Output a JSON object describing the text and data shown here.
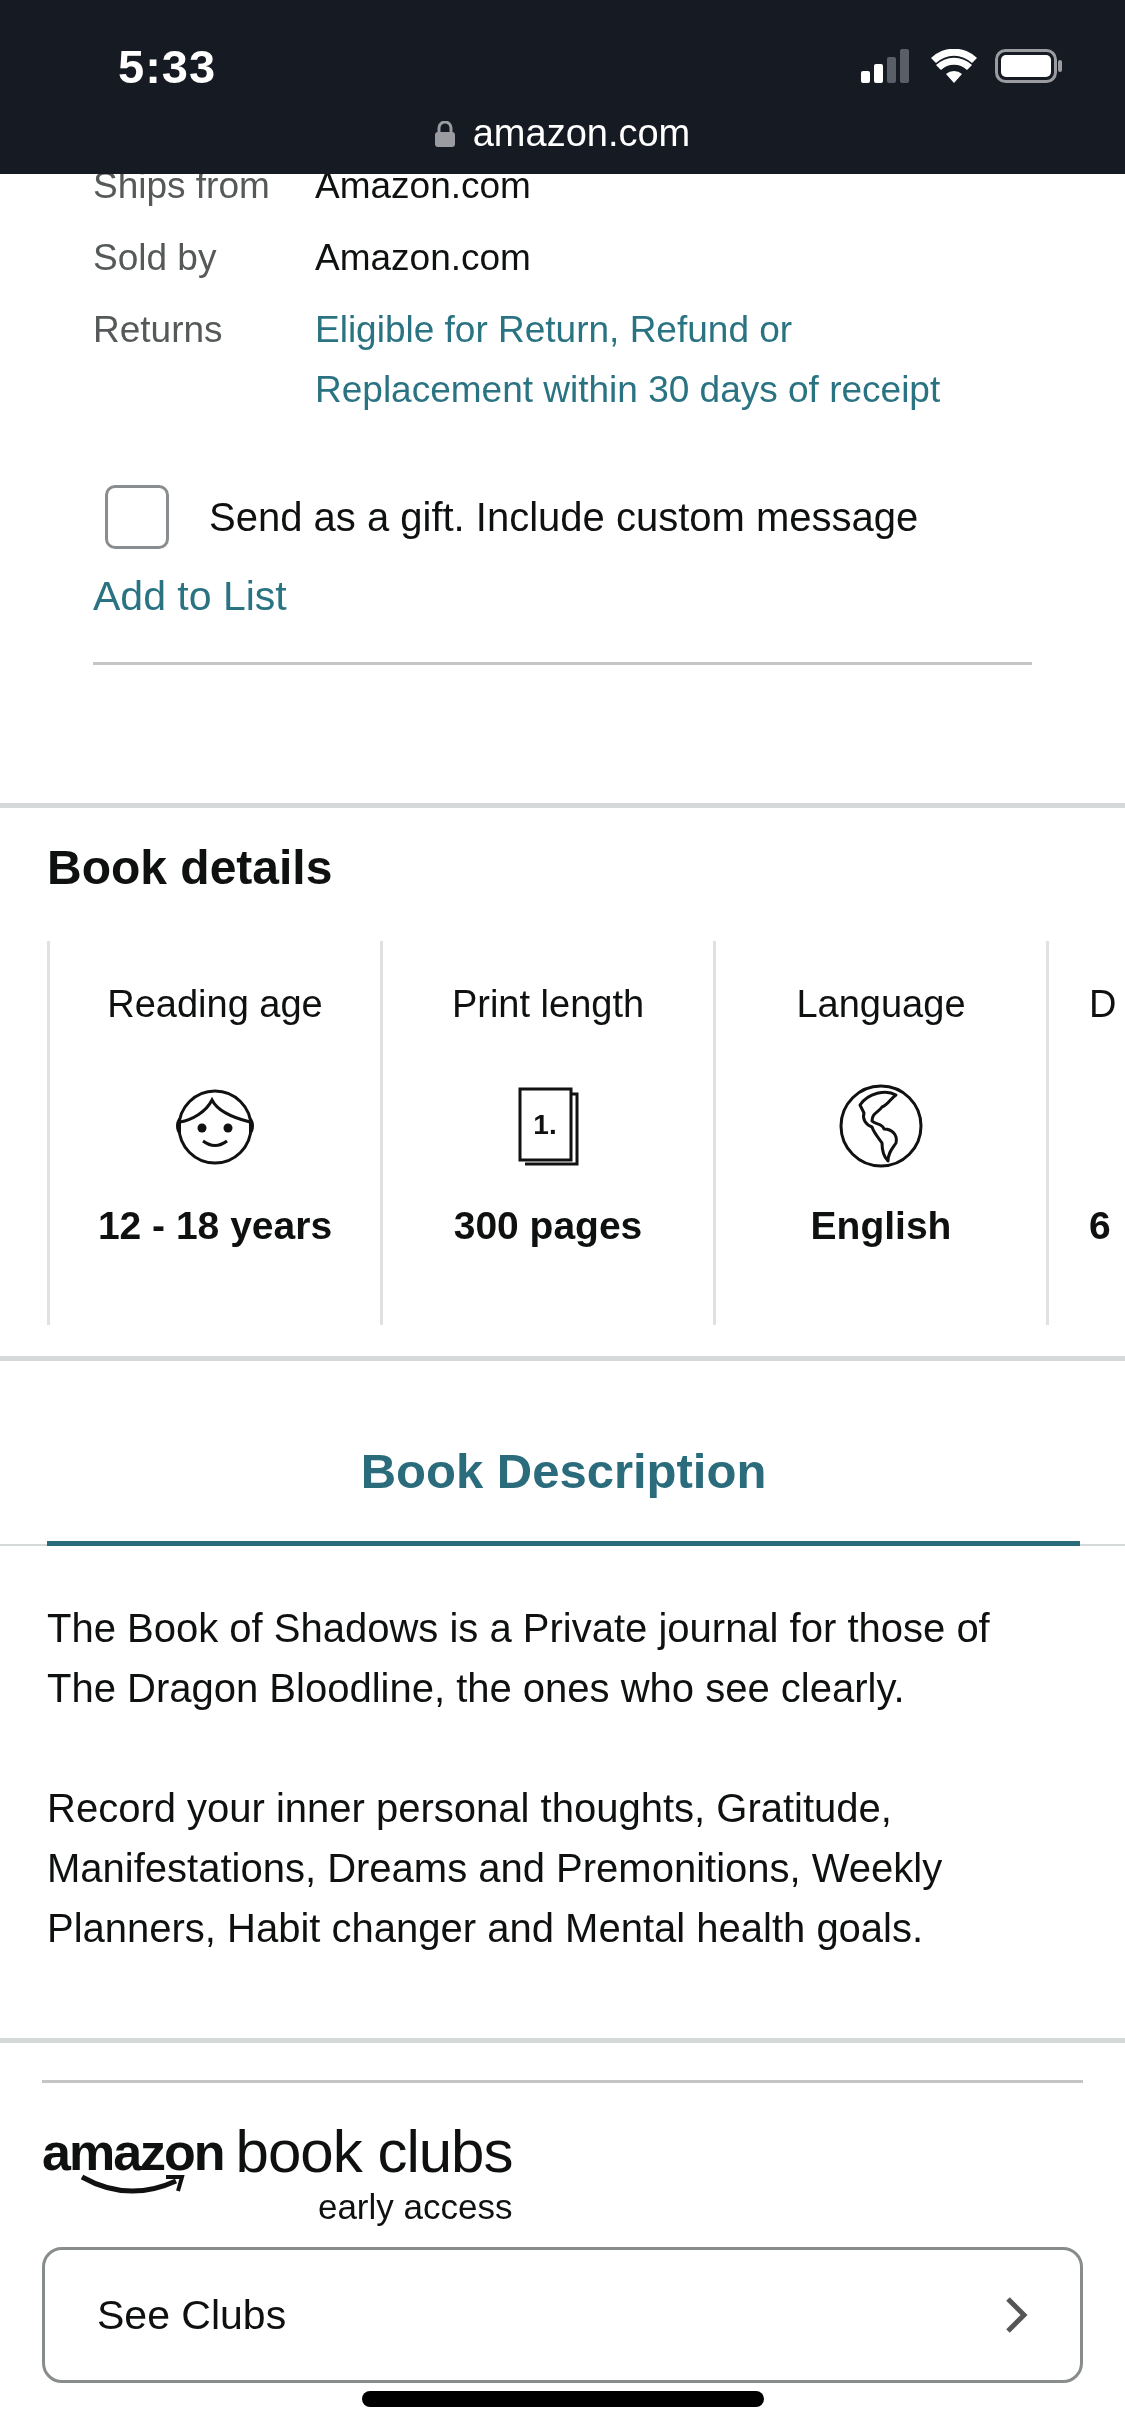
{
  "status_bar": {
    "time": "5:33",
    "url": "amazon.com"
  },
  "seller_info": {
    "rows": [
      {
        "label": "Ships from",
        "value": "Amazon.com",
        "kind": "text"
      },
      {
        "label": "Sold by",
        "value": "Amazon.com",
        "kind": "text"
      },
      {
        "label": "Returns",
        "value": "Eligible for Return, Refund or Replacement within 30 days of receipt",
        "kind": "link"
      }
    ],
    "gift_option": {
      "label": "Send as a gift. Include custom message",
      "checked": false
    },
    "add_to_list": "Add to List"
  },
  "book_details": {
    "title": "Book details",
    "cards": [
      {
        "kind": "age",
        "label": "Reading age",
        "value": "12 - 18 years"
      },
      {
        "kind": "pages",
        "label": "Print length",
        "icon_text": "1.",
        "value": "300 pages"
      },
      {
        "kind": "language",
        "label": "Language",
        "value": "English"
      },
      {
        "kind": "partial",
        "label": "D",
        "value": "6"
      }
    ]
  },
  "description": {
    "tab": {
      "label": "Book Description",
      "selected": true
    },
    "paragraphs": [
      "The Book of Shadows is a Private journal for those of The Dragon Bloodline, the ones who see clearly.",
      "Record your inner personal thoughts, Gratitude, Manifestations, Dreams and Premonitions, Weekly Planners, Habit changer and Mental health goals."
    ]
  },
  "book_clubs": {
    "logo": {
      "brand": "amazon",
      "name": "book clubs",
      "tagline": "early access"
    },
    "button": "See Clubs"
  }
}
